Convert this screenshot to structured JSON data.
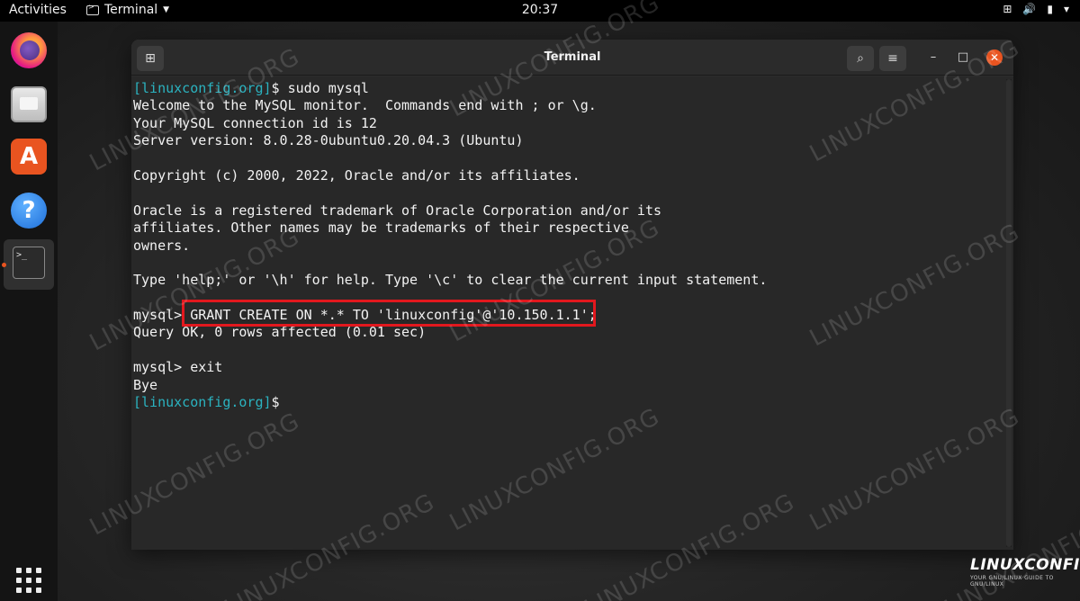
{
  "topbar": {
    "activities": "Activities",
    "app_name": "Terminal",
    "clock": "20:37",
    "tray_icons": [
      "network-icon",
      "volume-icon",
      "battery-icon",
      "power-menu-icon"
    ]
  },
  "dock": {
    "apps": [
      "firefox",
      "files",
      "app-center",
      "help",
      "terminal"
    ]
  },
  "window": {
    "title": "Terminal",
    "lines": [
      {
        "prompt": "[linuxconfig.org]",
        "text": "$ sudo mysql"
      },
      {
        "prompt": "",
        "text": "Welcome to the MySQL monitor.  Commands end with ; or \\g."
      },
      {
        "prompt": "",
        "text": "Your MySQL connection id is 12"
      },
      {
        "prompt": "",
        "text": "Server version: 8.0.28-0ubuntu0.20.04.3 (Ubuntu)"
      },
      {
        "prompt": "",
        "text": ""
      },
      {
        "prompt": "",
        "text": "Copyright (c) 2000, 2022, Oracle and/or its affiliates."
      },
      {
        "prompt": "",
        "text": ""
      },
      {
        "prompt": "",
        "text": "Oracle is a registered trademark of Oracle Corporation and/or its"
      },
      {
        "prompt": "",
        "text": "affiliates. Other names may be trademarks of their respective"
      },
      {
        "prompt": "",
        "text": "owners."
      },
      {
        "prompt": "",
        "text": ""
      },
      {
        "prompt": "",
        "text": "Type 'help;' or '\\h' for help. Type '\\c' to clear the current input statement."
      },
      {
        "prompt": "",
        "text": ""
      },
      {
        "prompt": "",
        "text": "mysql> GRANT CREATE ON *.* TO 'linuxconfig'@'10.150.1.1';"
      },
      {
        "prompt": "",
        "text": "Query OK, 0 rows affected (0.01 sec)"
      },
      {
        "prompt": "",
        "text": ""
      },
      {
        "prompt": "",
        "text": "mysql> exit"
      },
      {
        "prompt": "",
        "text": "Bye"
      },
      {
        "prompt": "[linuxconfig.org]",
        "text": "$ "
      }
    ]
  },
  "colors": {
    "accent": "#e95420",
    "prompt": "#2bb3c0",
    "highlight": "#e2181e"
  },
  "watermark": "LINUXCONFIG.ORG",
  "logo": {
    "name": "LINUXCONFIG",
    "tagline": "YOUR GNU/LINUX GUIDE TO GNU/LINUX"
  }
}
